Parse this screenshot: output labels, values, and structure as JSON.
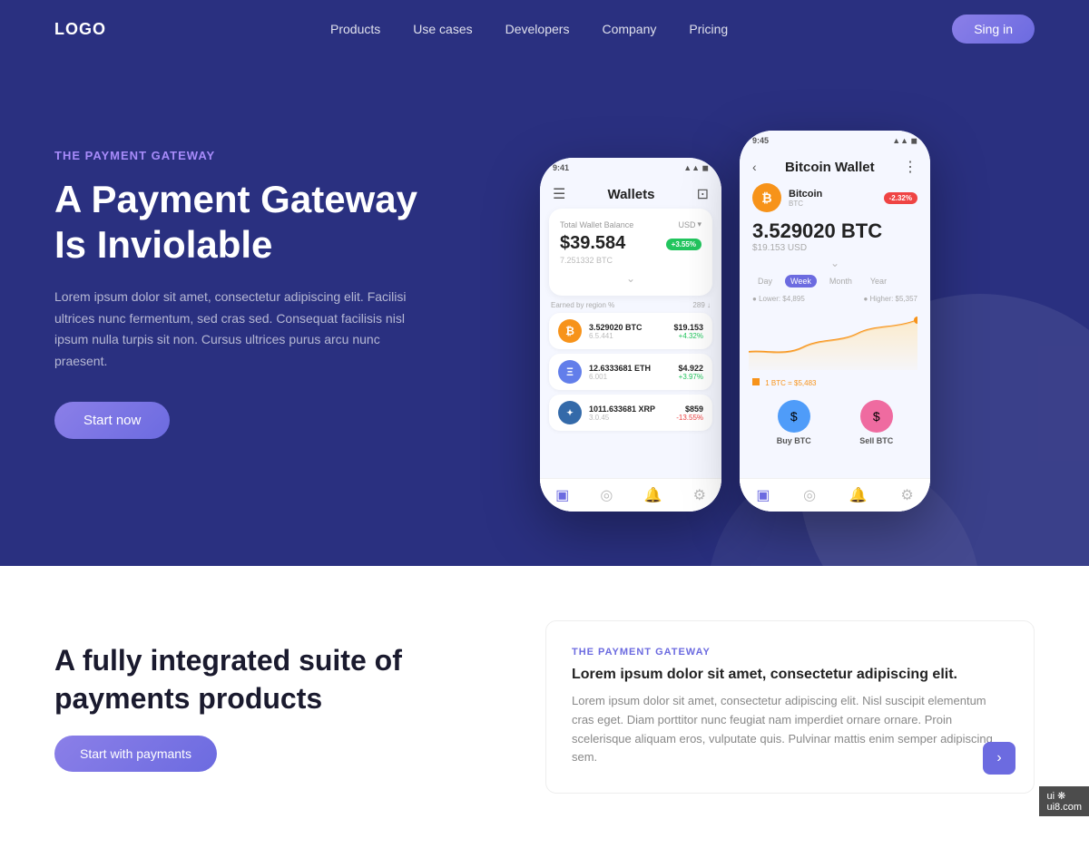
{
  "header": {
    "logo": "LOGO",
    "nav": [
      "Products",
      "Use cases",
      "Developers",
      "Company",
      "Pricing"
    ],
    "signin": "Sing in"
  },
  "hero": {
    "label": "THE PAYMENT GATEWAY",
    "title": "A Payment Gateway\nIs Inviolable",
    "description": "Lorem ipsum dolor sit amet, consectetur adipiscing elit. Facilisi ultrices nunc fermentum, sed cras sed. Consequat facilisis nisl ipsum nulla turpis sit non. Cursus ultrices purus arcu nunc praesent.",
    "cta": "Start now"
  },
  "phone_left": {
    "time": "9:41",
    "title": "Wallets",
    "balance_label": "Total Wallet Balance",
    "currency": "USD",
    "balance": "$39.584",
    "balance_btc": "7.251332 BTC",
    "badge": "+3.55%",
    "earn_label": "Earned by region %",
    "earn_value": "289 ↓",
    "coins": [
      {
        "symbol": "BTC",
        "color": "#f7931a",
        "amount": "3.529020 BTC",
        "units": "6.5.441",
        "usd": "$19.153",
        "change": "+4.32%",
        "positive": true
      },
      {
        "symbol": "ETH",
        "color": "#627eea",
        "amount": "12.6333681 ETH",
        "units": "6.001",
        "usd": "$4.922",
        "change": "+3.97%",
        "positive": true
      },
      {
        "symbol": "XRP",
        "color": "#346aa9",
        "amount": "1011.633681 XRP",
        "units": "3.0.45",
        "usd": "$859",
        "change": "-13.55%",
        "positive": false
      }
    ]
  },
  "phone_right": {
    "time": "9:45",
    "title": "Bitcoin Wallet",
    "coin_name": "Bitcoin",
    "coin_abbr": "BTC",
    "amount": "3.529020 BTC",
    "usd": "$19.153 USD",
    "badge": "-2.32%",
    "chart_tabs": [
      "Day",
      "Week",
      "Month",
      "Year"
    ],
    "active_tab": "Week",
    "lower": "Lower: $4,895",
    "higher": "Higher: $5,357",
    "chart_note": "1 BTC = $5,483",
    "buy_label": "Buy BTC",
    "sell_label": "Sell BTC"
  },
  "section2": {
    "title": "A fully integrated suite of payments products",
    "cta": "Start with paymants",
    "right_label": "THE PAYMENT GATEWAY",
    "right_title": "Lorem ipsum dolor sit amet, consectetur adipiscing elit.",
    "right_desc": "Lorem ipsum dolor sit amet, consectetur adipiscing elit. Nisl suscipit elementum cras eget. Diam porttitor nunc feugiat nam imperdiet ornare ornare. Proin scelerisque aliquam eros, vulputate quis. Pulvinar mattis enim semper adipiscing sem."
  },
  "watermark": {
    "site": "ui8.com",
    "logo": "ui8"
  }
}
